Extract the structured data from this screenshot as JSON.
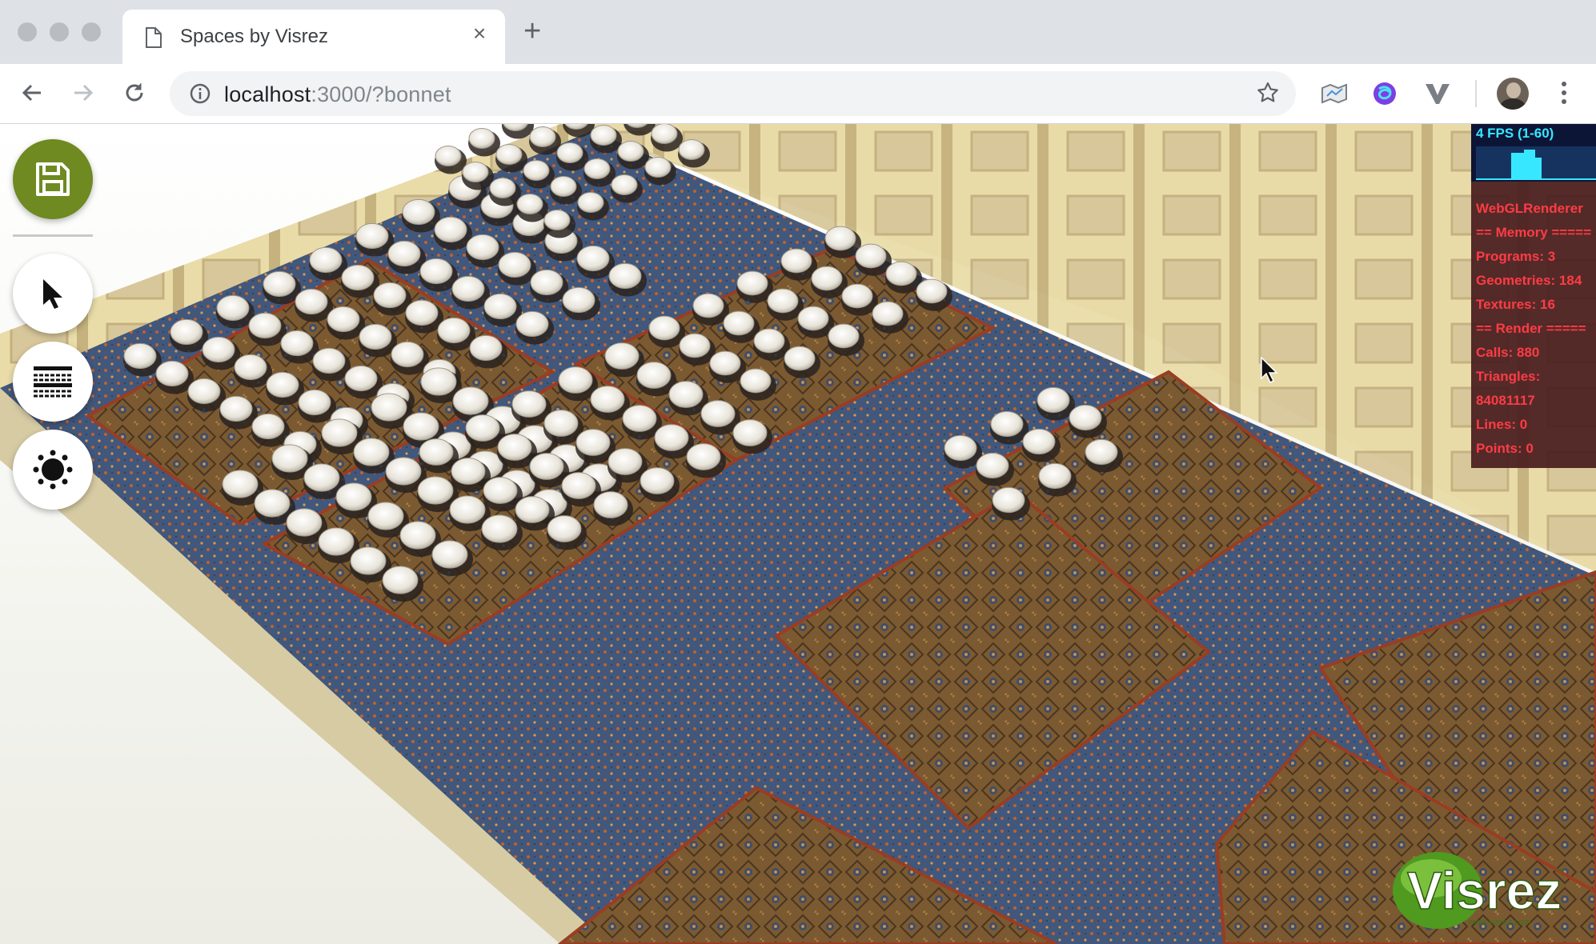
{
  "browser": {
    "tab_title": "Spaces by Visrez",
    "new_tab_label": "+",
    "close_label": "×",
    "url_host": "localhost",
    "url_path": ":3000/?bonnet"
  },
  "app": {
    "tools": [
      "save",
      "select",
      "seating-layout",
      "lighting"
    ],
    "accent_color": "#6e8a20",
    "stats": {
      "fps": "4 FPS (1-60)",
      "renderer": "WebGLRenderer",
      "memory_header": "== Memory =====",
      "programs": "Programs: 3",
      "geometries": "Geometries: 184",
      "textures": "Textures: 16",
      "render_header": "== Render =====",
      "calls": "Calls: 880",
      "triangles_label": "Triangles:",
      "triangles_value": "84081117",
      "lines": "Lines: 0",
      "points": "Points: 0"
    },
    "logo": {
      "name": "Visrez",
      "tm": "™",
      "url": "www.visrez.com"
    }
  }
}
